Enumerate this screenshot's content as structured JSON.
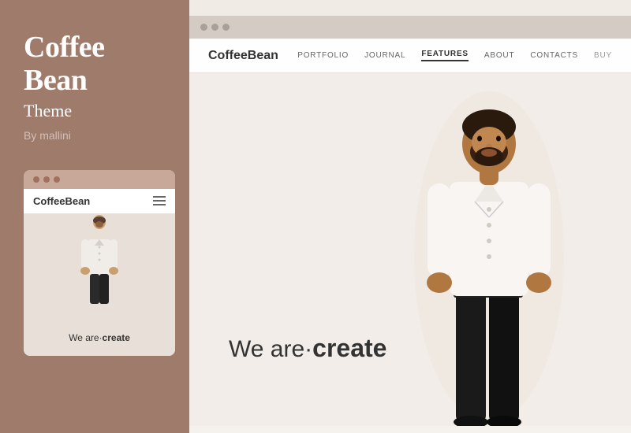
{
  "left": {
    "title_line1": "Coffee",
    "title_line2": "Bean",
    "subtitle": "Theme",
    "author": "By mallini"
  },
  "mobile_preview": {
    "logo_regular": "Coffee",
    "logo_bold": "Bean",
    "hero_text_regular": "We are·",
    "hero_text_bold": "create"
  },
  "desktop_preview": {
    "logo_regular": "Coffee",
    "logo_bold": "Bean",
    "nav_items": [
      {
        "label": "PORTFOLIO",
        "active": false
      },
      {
        "label": "JOURNAL",
        "active": false
      },
      {
        "label": "FEATURES",
        "active": true
      },
      {
        "label": "ABOUT",
        "active": false
      },
      {
        "label": "CONTACTS",
        "active": false
      },
      {
        "label": "BUY",
        "active": false
      }
    ],
    "hero_text_regular": "We are·",
    "hero_text_bold": "create"
  },
  "colors": {
    "left_bg": "#9e7b6b",
    "card_bg": "#f5f0ee",
    "hero_bg": "#f2ede8"
  }
}
